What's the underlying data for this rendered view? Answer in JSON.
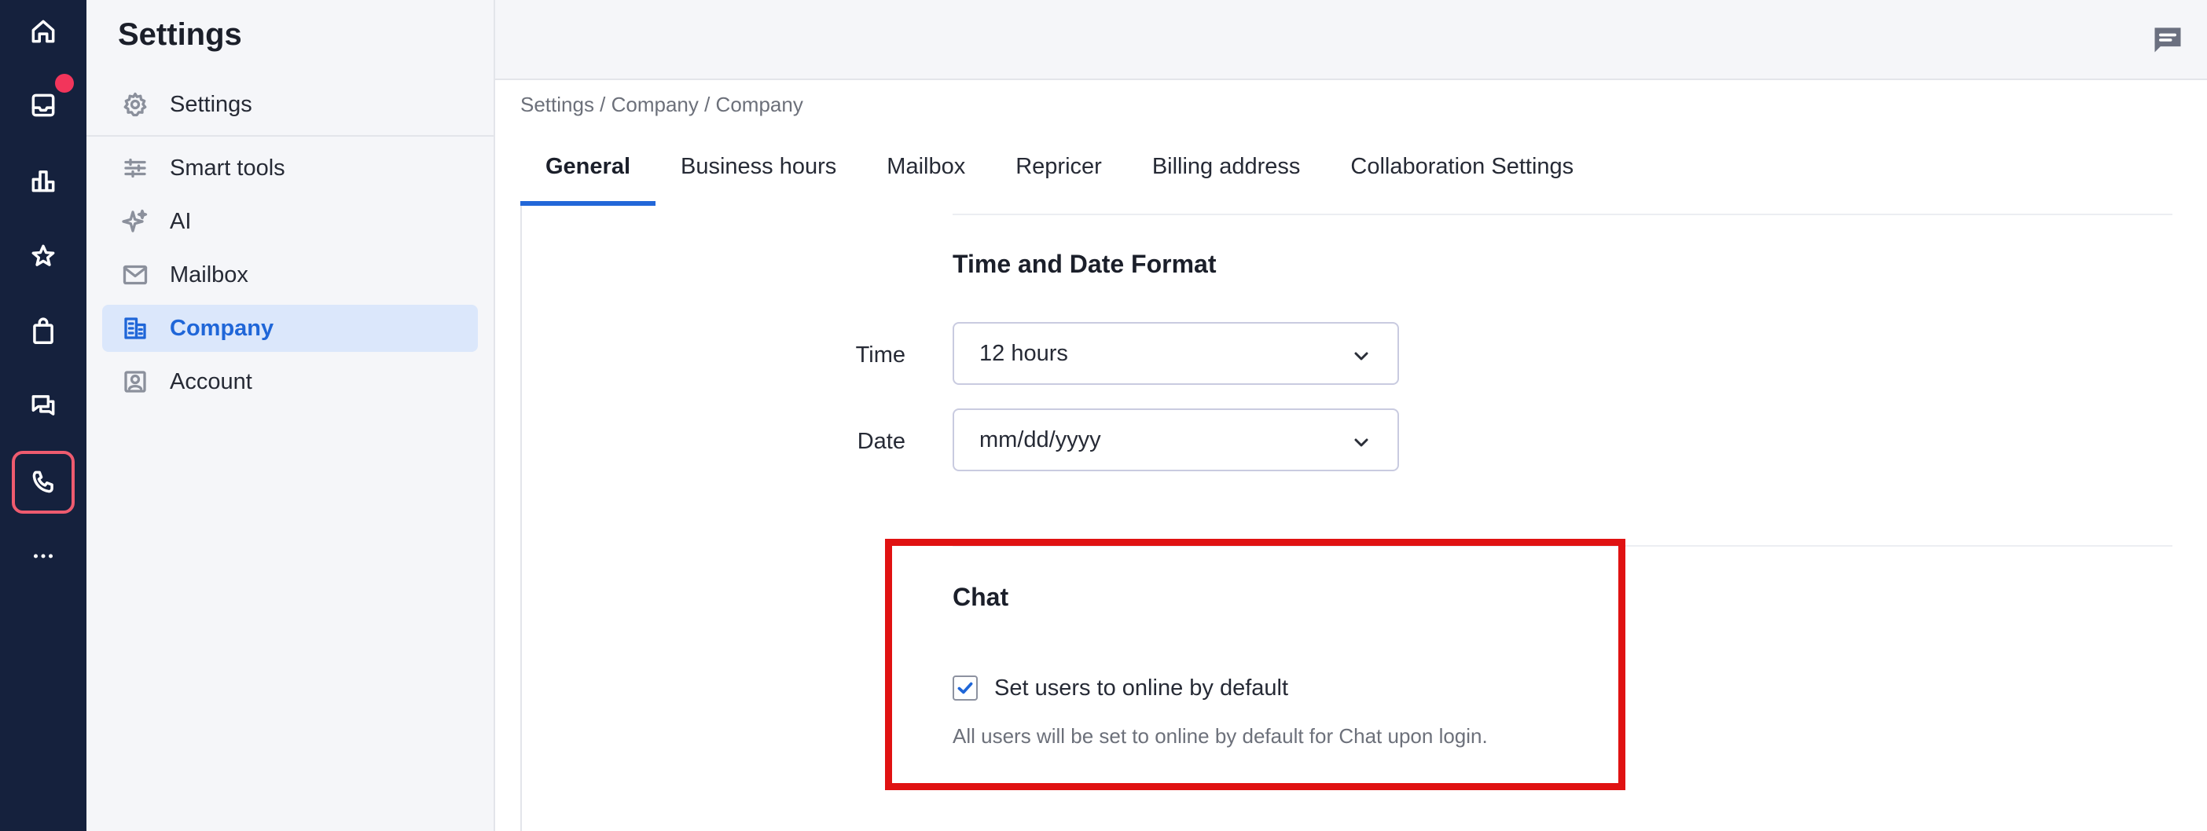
{
  "rail": {
    "items": [
      {
        "name": "home-icon"
      },
      {
        "name": "inbox-icon"
      },
      {
        "name": "reports-icon"
      },
      {
        "name": "star-icon"
      },
      {
        "name": "shopping-bag-icon"
      },
      {
        "name": "conversations-icon"
      },
      {
        "name": "phone-icon"
      },
      {
        "name": "more-icon"
      }
    ],
    "badge_color": "#f2355b"
  },
  "sidebar": {
    "title": "Settings",
    "items": [
      {
        "label": "Settings",
        "icon": "gear-icon"
      },
      {
        "label": "Smart tools",
        "icon": "sliders-icon"
      },
      {
        "label": "AI",
        "icon": "sparkle-icon"
      },
      {
        "label": "Mailbox",
        "icon": "mail-icon"
      },
      {
        "label": "Company",
        "icon": "building-icon",
        "active": true
      },
      {
        "label": "Account",
        "icon": "account-icon"
      }
    ]
  },
  "header": {
    "breadcrumb": "Settings / Company / Company",
    "tabs": [
      {
        "label": "General",
        "active": true
      },
      {
        "label": "Business hours"
      },
      {
        "label": "Mailbox"
      },
      {
        "label": "Repricer"
      },
      {
        "label": "Billing address"
      },
      {
        "label": "Collaboration Settings"
      }
    ]
  },
  "time_date": {
    "title": "Time and Date Format",
    "time_label": "Time",
    "time_value": "12 hours",
    "date_label": "Date",
    "date_value": "mm/dd/yyyy"
  },
  "chat": {
    "title": "Chat",
    "checkbox_label": "Set users to online by default",
    "checked": true,
    "helper": "All users will be set to online by default for Chat upon login."
  },
  "colors": {
    "accent": "#1f66d8",
    "rail_bg": "#15213d",
    "highlight": "#e01212"
  }
}
